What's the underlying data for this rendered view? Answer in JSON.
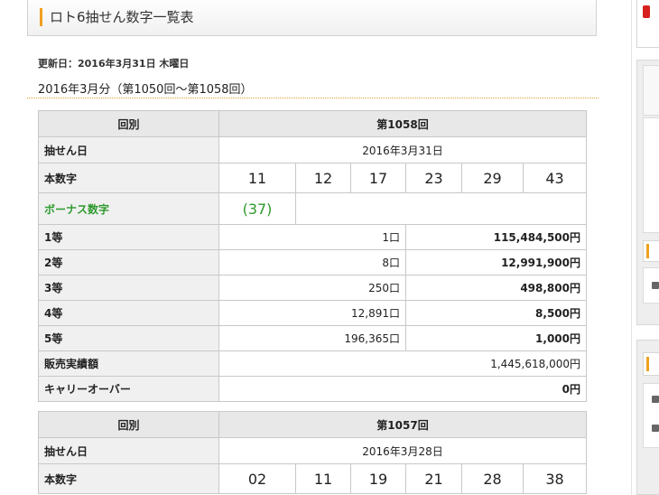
{
  "page": {
    "title": "ロト6抽せん数字一覧表",
    "updated": "更新日：2016年3月31日 木曜日",
    "period": "2016年3月分（第1050回〜第1058回）"
  },
  "labels": {
    "round": "回別",
    "draw_date": "抽せん日",
    "main_numbers": "本数字",
    "bonus": "ボーナス数字",
    "prize1": "1等",
    "prize2": "2等",
    "prize3": "3等",
    "prize4": "4等",
    "prize5": "5等",
    "sales": "販売実績額",
    "carryover": "キャリーオーバー"
  },
  "draws": [
    {
      "round": "第1058回",
      "date": "2016年3月31日",
      "numbers": [
        "11",
        "12",
        "17",
        "23",
        "29",
        "43"
      ],
      "bonus": "(37)",
      "prizes": [
        {
          "winners": "1口",
          "amount": "115,484,500円"
        },
        {
          "winners": "8口",
          "amount": "12,991,900円"
        },
        {
          "winners": "250口",
          "amount": "498,800円"
        },
        {
          "winners": "12,891口",
          "amount": "8,500円"
        },
        {
          "winners": "196,365口",
          "amount": "1,000円"
        }
      ],
      "sales": "1,445,618,000円",
      "carryover": "0円"
    },
    {
      "round": "第1057回",
      "date": "2016年3月28日",
      "numbers": [
        "02",
        "11",
        "19",
        "21",
        "28",
        "38"
      ]
    }
  ],
  "colors": {
    "accent": "#f0a020",
    "bonus": "#2e9a2e",
    "sidebar_red": "#d62020"
  }
}
